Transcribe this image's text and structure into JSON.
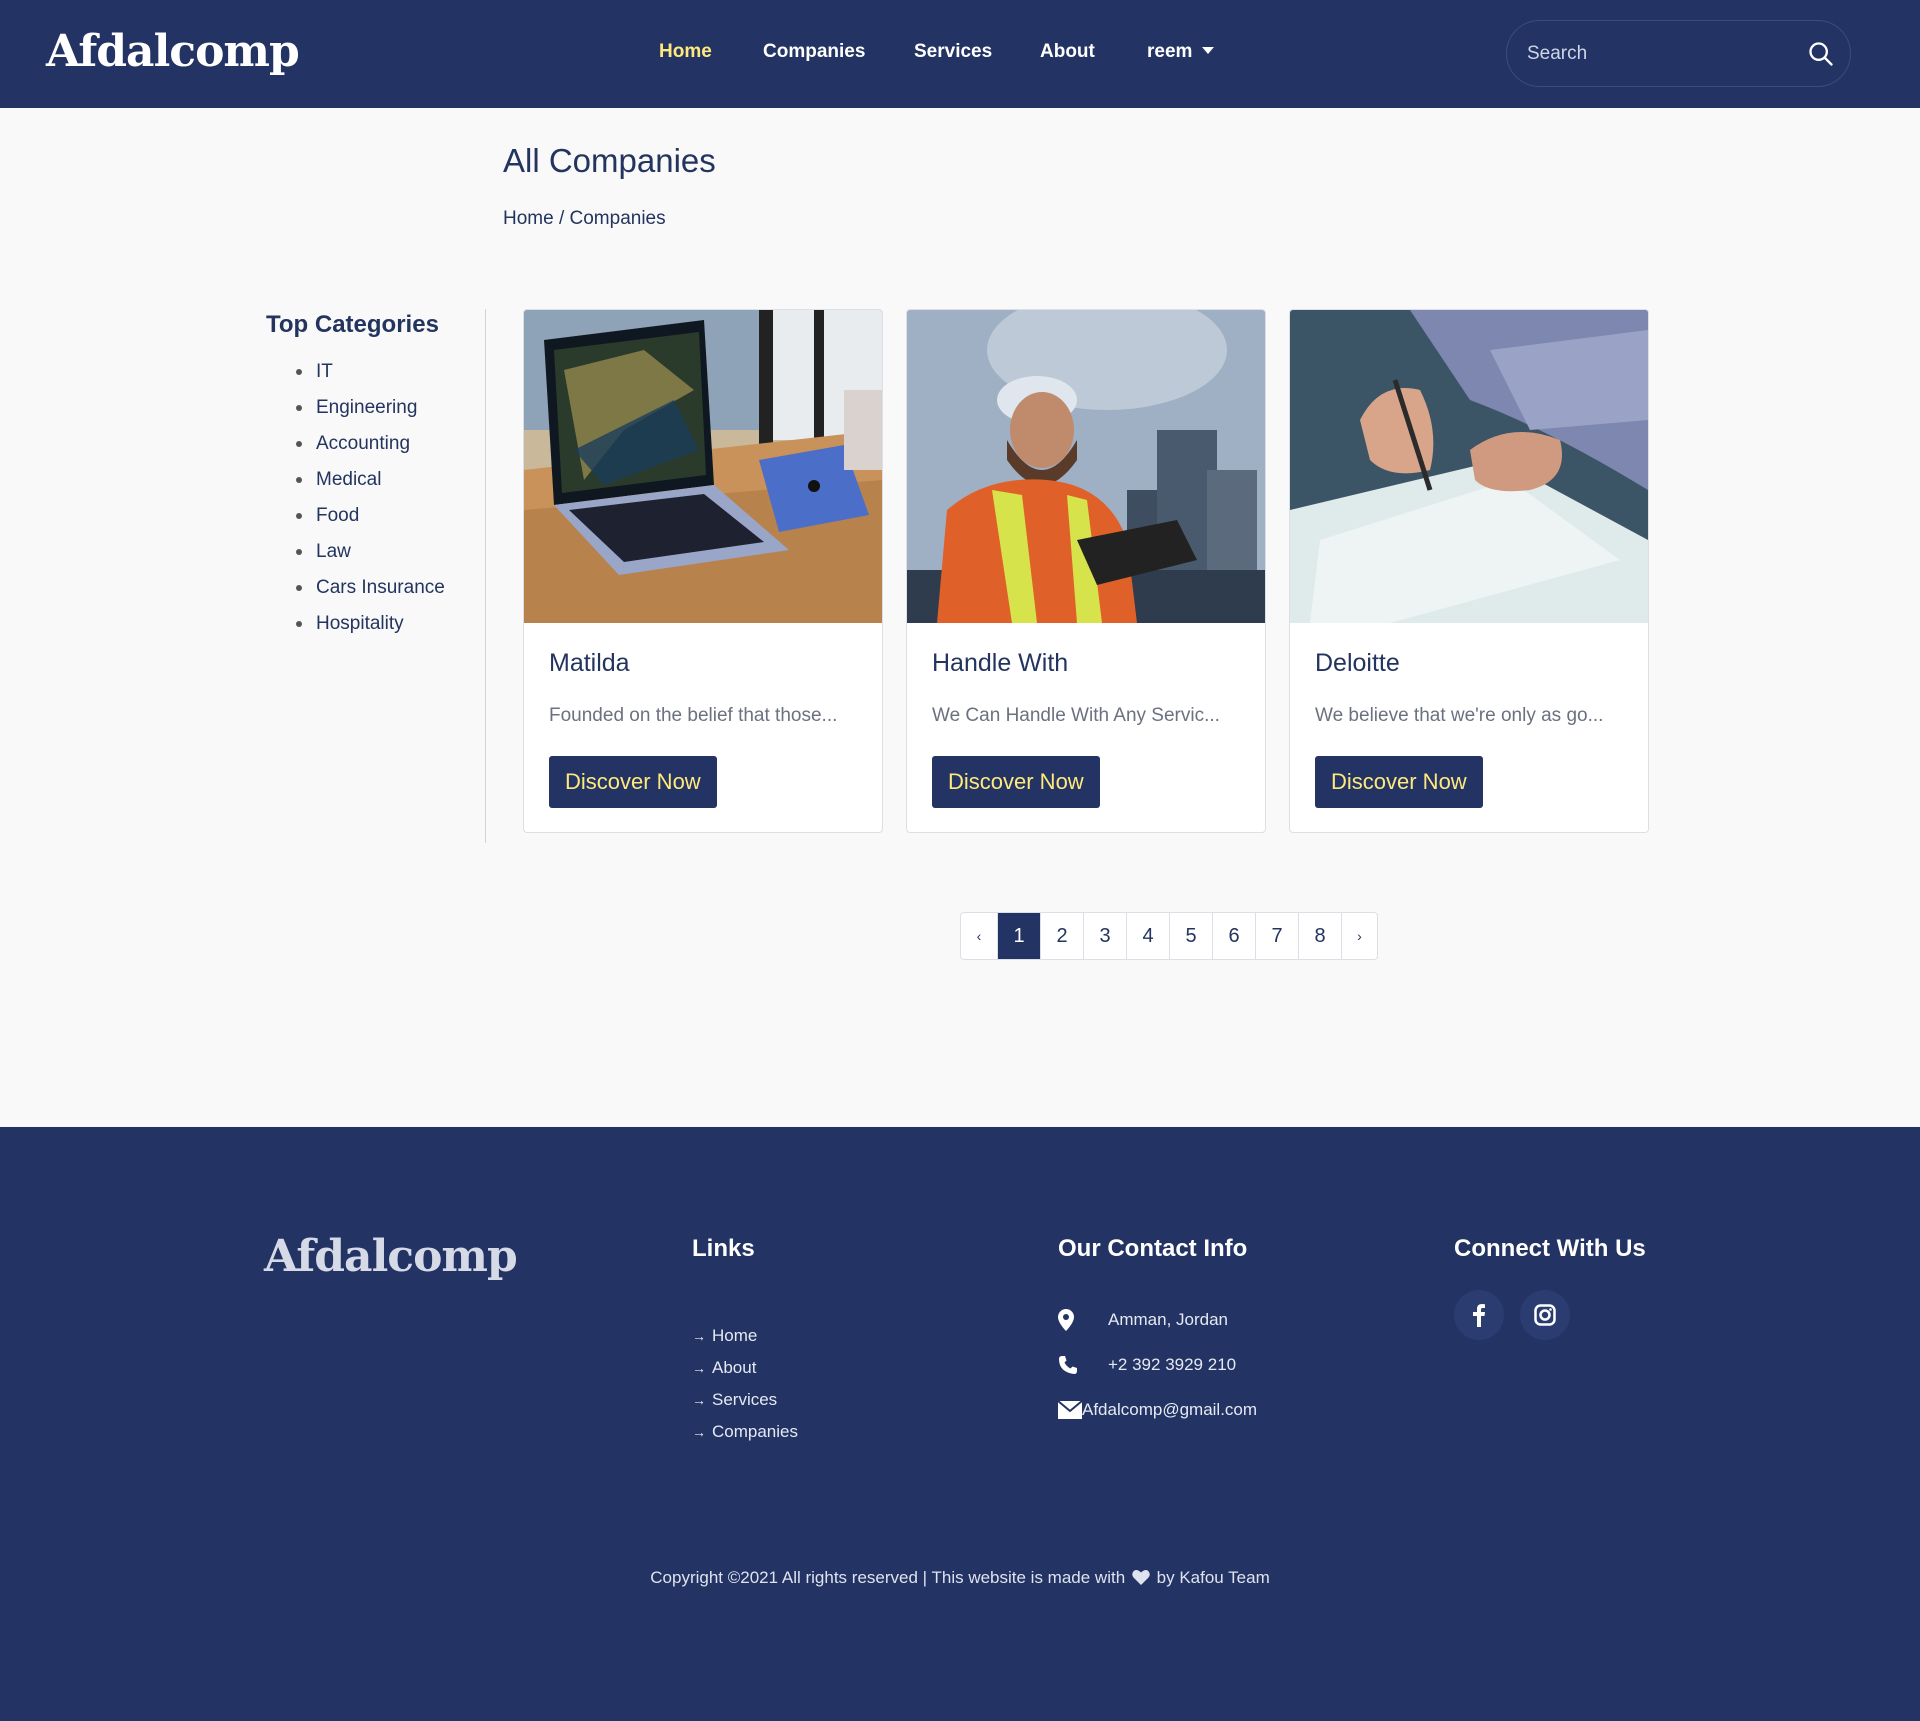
{
  "brand": {
    "name": "Afdalcomp"
  },
  "nav": {
    "items": [
      {
        "label": "Home",
        "active": true
      },
      {
        "label": "Companies",
        "active": false
      },
      {
        "label": "Services",
        "active": false
      },
      {
        "label": "About",
        "active": false
      }
    ],
    "user": "reem",
    "search_placeholder": "Search"
  },
  "header": {
    "title": "All Companies",
    "breadcrumb": "Home / Companies"
  },
  "sidebar": {
    "title": "Top Categories",
    "categories": [
      "IT",
      "Engineering",
      "Accounting",
      "Medical",
      "Food",
      "Law",
      "Cars Insurance",
      "Hospitality"
    ]
  },
  "companies": [
    {
      "name": "Matilda",
      "description": "Founded on the belief that those...",
      "button": "Discover Now"
    },
    {
      "name": "Handle With",
      "description": "We Can Handle With Any Servic...",
      "button": "Discover Now"
    },
    {
      "name": "Deloitte",
      "description": "We believe that we're only as go...",
      "button": "Discover Now"
    }
  ],
  "pagination": {
    "prev": "‹",
    "next": "›",
    "pages": [
      "1",
      "2",
      "3",
      "4",
      "5",
      "6",
      "7",
      "8"
    ],
    "current": "1"
  },
  "footer": {
    "brand": "Afdalcomp",
    "links_title": "Links",
    "links": [
      "Home",
      "About",
      "Services",
      "Companies"
    ],
    "contact_title": "Our Contact Info",
    "contact": {
      "address": "Amman, Jordan",
      "phone": "+2 392 3929 210",
      "email": "Afdalcomp@gmail.com"
    },
    "connect_title": "Connect With Us",
    "copyright_before": "Copyright ©2021 All rights reserved | This website is made with",
    "copyright_after": "by Kafou Team"
  },
  "colors": {
    "primary": "#223364",
    "accent": "#ffe97d",
    "background": "#f9f9f9"
  },
  "icons": [
    "search-icon",
    "caret-down-icon",
    "location-pin-icon",
    "phone-icon",
    "envelope-icon",
    "facebook-icon",
    "instagram-icon",
    "heart-icon",
    "arrow-right-icon"
  ]
}
